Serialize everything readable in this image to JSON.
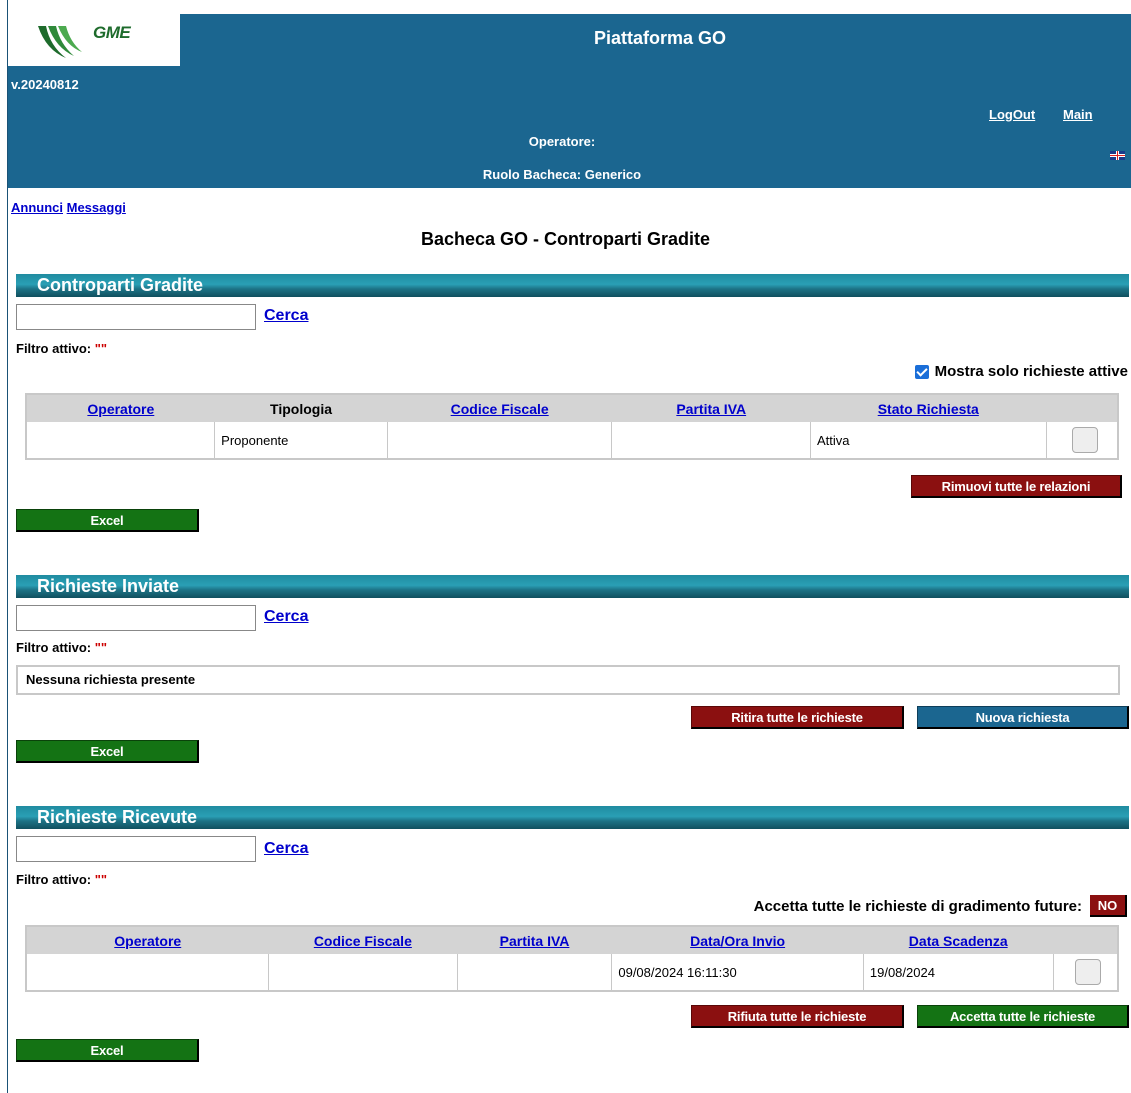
{
  "header": {
    "logo_text": "GME",
    "app_title": "Piattaforma GO",
    "version": "v.20240812",
    "logout_label": "LogOut",
    "main_label": "Main",
    "operatore_label": "Operatore:",
    "ruolo_label": "Ruolo Bacheca:",
    "ruolo_value": "Generico"
  },
  "nav": {
    "annunci": "Annunci",
    "messaggi": "Messaggi"
  },
  "page_title": "Bacheca GO - Controparti Gradite",
  "sections": {
    "controparti": {
      "title": "Controparti Gradite",
      "search_value": "",
      "cerca": "Cerca",
      "filtro_label": "Filtro attivo:",
      "filtro_value": "\"\"",
      "mostra_label": "Mostra solo richieste attive",
      "mostra_checked": true,
      "columns": [
        "Operatore",
        "Tipologia",
        "Codice Fiscale",
        "Partita IVA",
        "Stato Richiesta"
      ],
      "rows": [
        {
          "operatore": "",
          "tipologia": "Proponente",
          "codice_fiscale": "",
          "partita_iva": "",
          "stato": "Attiva"
        }
      ],
      "rimuovi_label": "Rimuovi tutte le relazioni",
      "excel_label": "Excel"
    },
    "inviate": {
      "title": "Richieste Inviate",
      "search_value": "",
      "cerca": "Cerca",
      "filtro_label": "Filtro attivo:",
      "filtro_value": "\"\"",
      "empty_message": "Nessuna richiesta presente",
      "ritira_label": "Ritira tutte le richieste",
      "nuova_label": "Nuova richiesta",
      "excel_label": "Excel"
    },
    "ricevute": {
      "title": "Richieste Ricevute",
      "search_value": "",
      "cerca": "Cerca",
      "filtro_label": "Filtro attivo:",
      "filtro_value": "\"\"",
      "accetta_future_label": "Accetta tutte le richieste di gradimento future:",
      "accetta_future_value": "NO",
      "columns": [
        "Operatore",
        "Codice Fiscale",
        "Partita IVA",
        "Data/Ora Invio",
        "Data Scadenza"
      ],
      "rows": [
        {
          "operatore": "",
          "codice_fiscale": "",
          "partita_iva": "",
          "data_invio": "09/08/2024 16:11:30",
          "data_scadenza": "19/08/2024"
        }
      ],
      "rifiuta_label": "Rifiuta tutte le richieste",
      "accetta_label": "Accetta tutte le richieste",
      "excel_label": "Excel"
    }
  },
  "colors": {
    "header_bg": "#1b6690",
    "button_red": "#8b1010",
    "button_green": "#147314",
    "link": "#0000cc"
  }
}
